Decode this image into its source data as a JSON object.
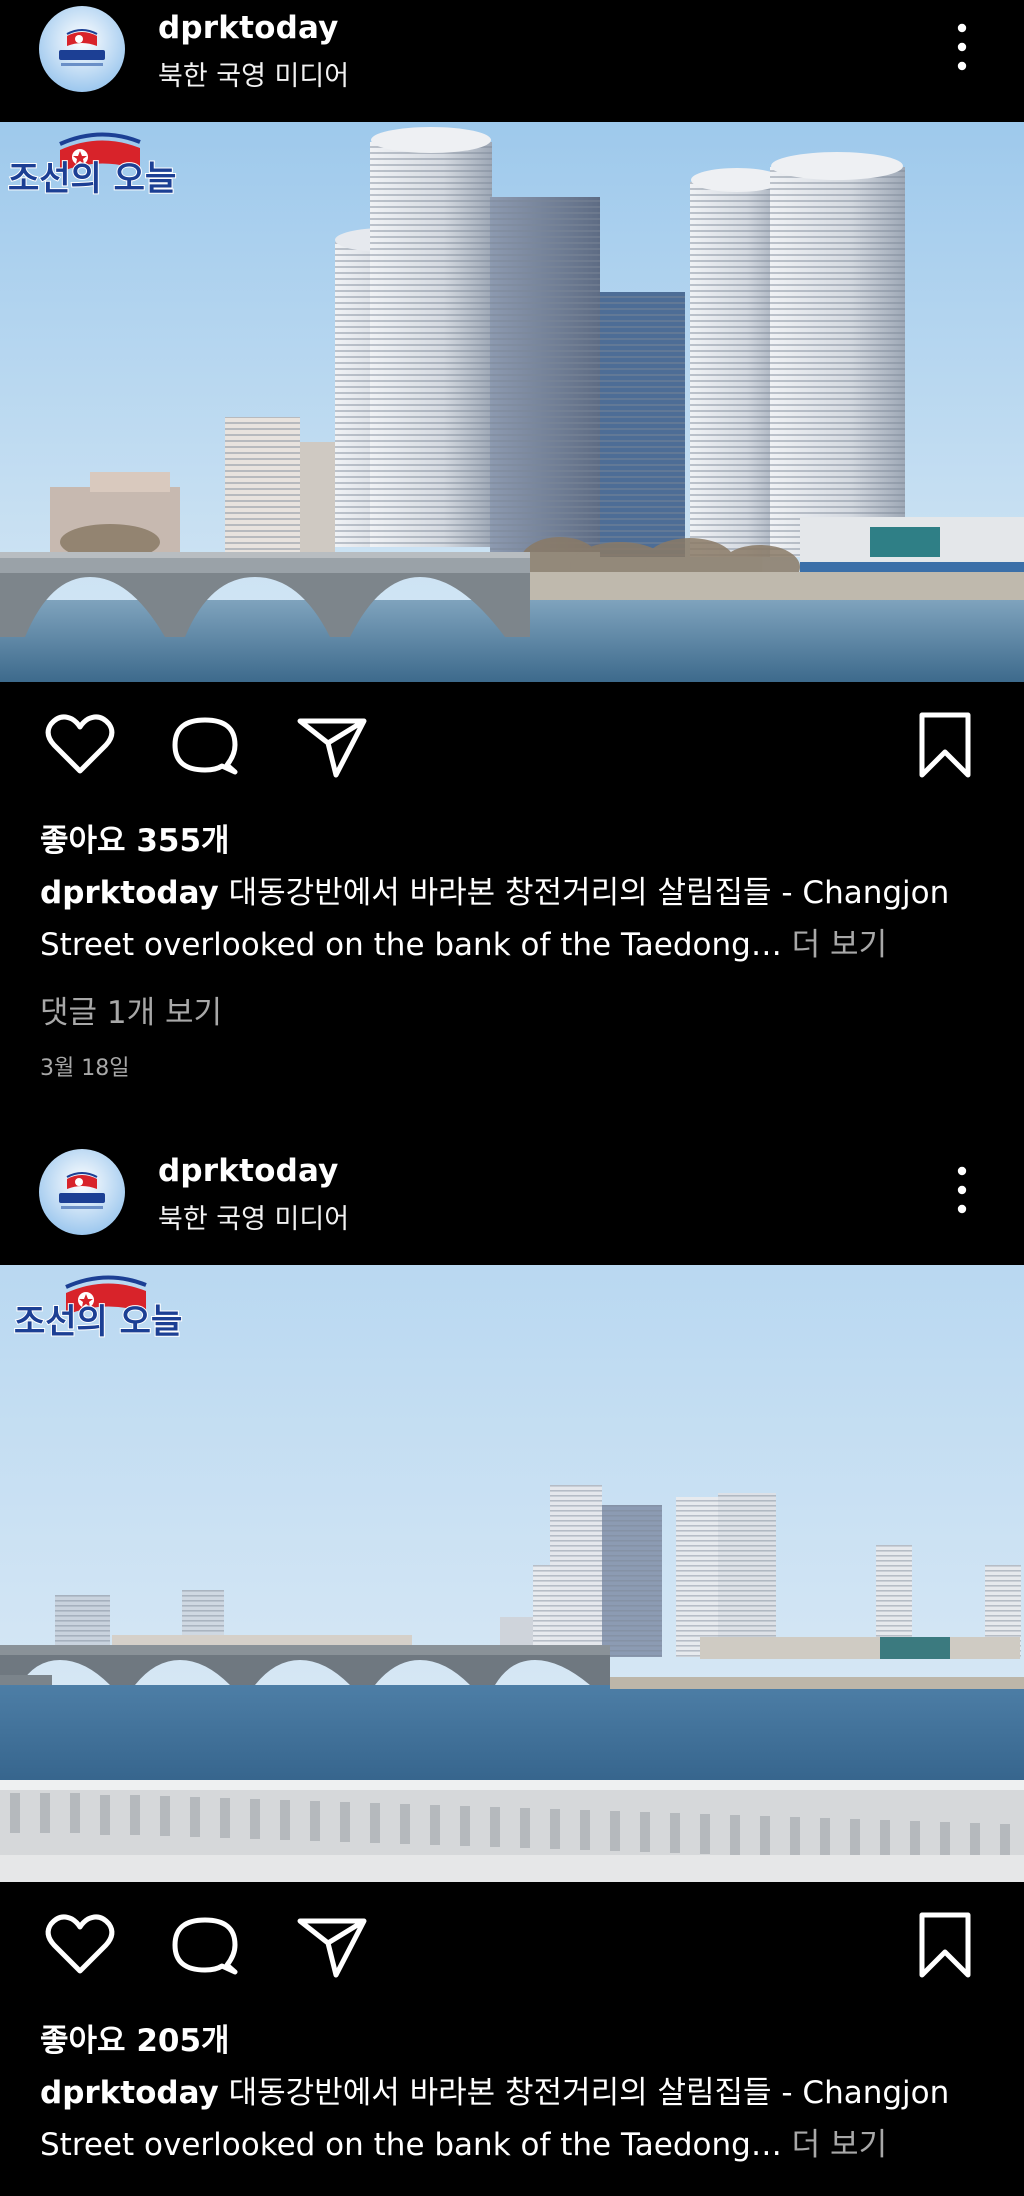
{
  "colors": {
    "background": "#000000",
    "text": "#ffffff",
    "muted": "#a8a8a8",
    "flag_red": "#d8232a",
    "flag_blue": "#1c3f94"
  },
  "posts": [
    {
      "username": "dprktoday",
      "subtitle": "북한 국영 미디어",
      "watermark": "조선의 오늘",
      "likes": "좋아요 355개",
      "caption_user": "dprktoday",
      "caption_line1": " 대동강반에서 바라본 창전거리의 살림집들 - Changjon",
      "caption_line2": "Street overlooked on the bank of the Taedong",
      "caption_ellipsis": "… ",
      "more_label": "더 보기",
      "view_comments": "댓글 1개 보기",
      "date": "3월 18일"
    },
    {
      "username": "dprktoday",
      "subtitle": "북한 국영 미디어",
      "watermark": "조선의 오늘",
      "likes": "좋아요 205개",
      "caption_user": "dprktoday",
      "caption_line1": " 대동강반에서 바라본 창전거리의 살림집들 - Changjon",
      "caption_line2": "Street overlooked on the bank of the Taedong",
      "caption_ellipsis": "… ",
      "more_label": "더 보기"
    }
  ],
  "icons": {
    "more": "vertical-dots-icon",
    "like": "heart-icon",
    "comment": "speech-bubble-icon",
    "share": "paper-plane-icon",
    "save": "bookmark-icon"
  }
}
